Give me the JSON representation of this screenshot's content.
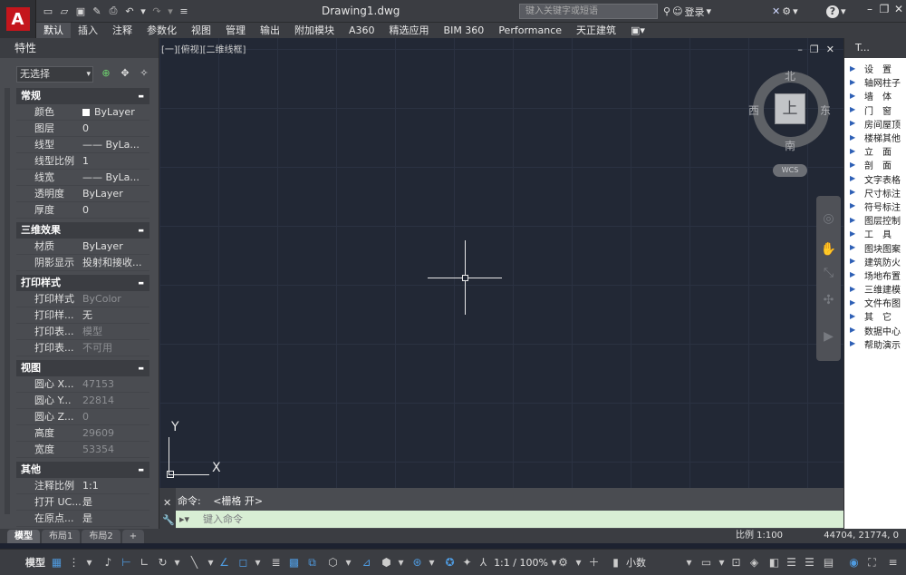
{
  "app": {
    "doc_title": "Drawing1.dwg",
    "search_placeholder": "键入关键字或短语",
    "login_label": "登录",
    "help_label": "?"
  },
  "ribbon": {
    "tabs": [
      "默认",
      "插入",
      "注释",
      "参数化",
      "视图",
      "管理",
      "输出",
      "附加模块",
      "A360",
      "精选应用",
      "BIM 360",
      "Performance",
      "天正建筑"
    ],
    "active_tab": "默认"
  },
  "properties": {
    "title": "特性",
    "selection": "无选择",
    "sections": [
      {
        "title": "常规",
        "rows": [
          {
            "k": "颜色",
            "v": "ByLayer",
            "swatch": "#ffffff"
          },
          {
            "k": "图层",
            "v": "0"
          },
          {
            "k": "线型",
            "v": "—— ByLa..."
          },
          {
            "k": "线型比例",
            "v": "1"
          },
          {
            "k": "线宽",
            "v": "—— ByLa..."
          },
          {
            "k": "透明度",
            "v": "ByLayer"
          },
          {
            "k": "厚度",
            "v": "0"
          }
        ]
      },
      {
        "title": "三维效果",
        "rows": [
          {
            "k": "材质",
            "v": "ByLayer"
          },
          {
            "k": "阴影显示",
            "v": "投射和接收..."
          }
        ]
      },
      {
        "title": "打印样式",
        "rows": [
          {
            "k": "打印样式",
            "v": "ByColor",
            "dim": true
          },
          {
            "k": "打印样...",
            "v": "无"
          },
          {
            "k": "打印表...",
            "v": "模型",
            "dim": true
          },
          {
            "k": "打印表...",
            "v": "不可用",
            "dim": true
          }
        ]
      },
      {
        "title": "视图",
        "rows": [
          {
            "k": "圆心 X...",
            "v": "47153",
            "dim": true
          },
          {
            "k": "圆心 Y...",
            "v": "22814",
            "dim": true
          },
          {
            "k": "圆心 Z...",
            "v": "0",
            "dim": true
          },
          {
            "k": "高度",
            "v": "29609",
            "dim": true
          },
          {
            "k": "宽度",
            "v": "53354",
            "dim": true
          }
        ]
      },
      {
        "title": "其他",
        "rows": [
          {
            "k": "注释比例",
            "v": "1:1"
          },
          {
            "k": "打开 UC...",
            "v": "是"
          },
          {
            "k": "在原点...",
            "v": "是"
          }
        ]
      }
    ]
  },
  "viewport": {
    "label": "[一][俯视][二维线框]",
    "viewcube": {
      "face": "上",
      "north": "北",
      "south": "南",
      "east": "东",
      "west": "西",
      "wcs": "WCS"
    },
    "ucs": {
      "x": "X",
      "y": "Y"
    }
  },
  "tool_palette": {
    "title": "T...",
    "items": [
      "设　置",
      "轴网柱子",
      "墙　体",
      "门　窗",
      "房间屋顶",
      "楼梯其他",
      "立　面",
      "剖　面",
      "文字表格",
      "尺寸标注",
      "符号标注",
      "图层控制",
      "工　具",
      "图块图案",
      "建筑防火",
      "场地布置",
      "三维建模",
      "文件布图",
      "其　它",
      "数据中心",
      "帮助演示"
    ]
  },
  "command": {
    "history_prefix": "命令:",
    "history_text": "<栅格 开>",
    "input_placeholder": "键入命令"
  },
  "layouts": {
    "tabs": [
      "模型",
      "布局1",
      "布局2"
    ],
    "add": "+"
  },
  "status": {
    "scale_text": "比例 1:100",
    "coords": "44704, 21774, 0",
    "model_label": "模型",
    "anno_scale": "1:1 / 100%",
    "units": "小数"
  },
  "colors": {
    "canvas": "#222835",
    "grid": "#2b3242",
    "accent_red": "#c4161c",
    "cmd_input": "#d8eed4"
  }
}
